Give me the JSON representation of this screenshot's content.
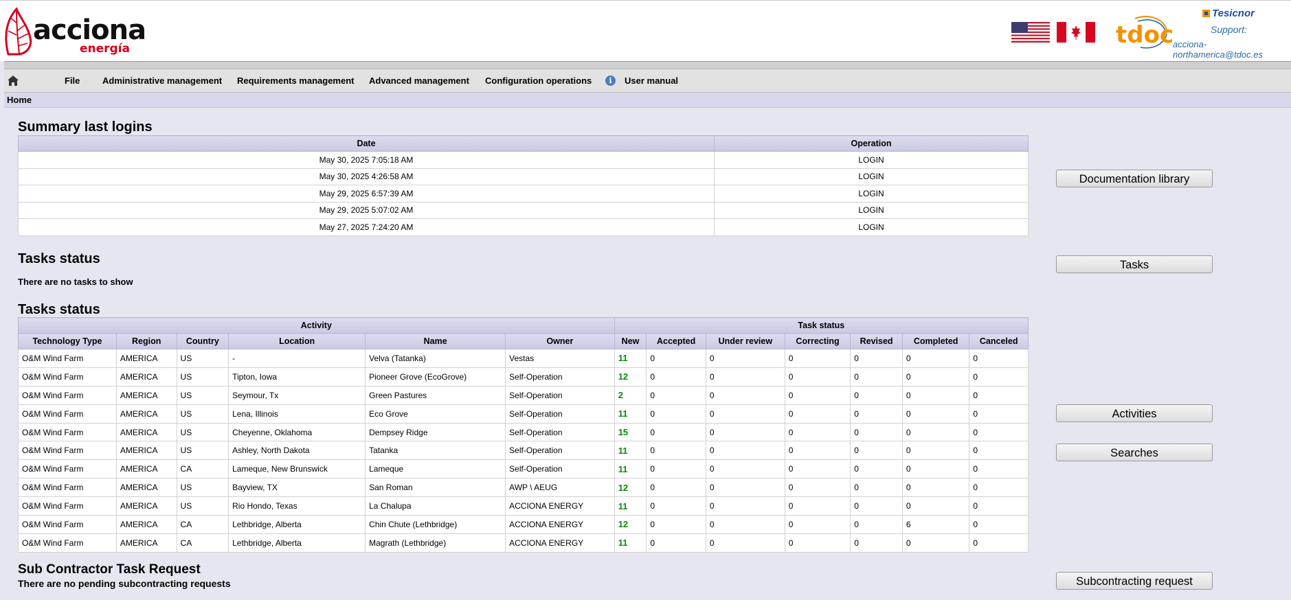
{
  "brand": {
    "name": "acciona",
    "sub": "energía"
  },
  "header": {
    "partner_logo": "tdoc",
    "vendor": "Tesicnor",
    "support_label": "Support:",
    "support_email": "acciona-northamerica@tdoc.es"
  },
  "menu": {
    "items": [
      "File",
      "Administrative management",
      "Requirements management",
      "Advanced management",
      "Configuration operations",
      "User manual"
    ]
  },
  "breadcrumb": "Home",
  "logins": {
    "title": "Summary last logins",
    "columns": [
      "Date",
      "Operation"
    ],
    "rows": [
      [
        "May 30, 2025 7:05:18 AM",
        "LOGIN"
      ],
      [
        "May 30, 2025 4:26:58 AM",
        "LOGIN"
      ],
      [
        "May 29, 2025 6:57:39 AM",
        "LOGIN"
      ],
      [
        "May 29, 2025 5:07:02 AM",
        "LOGIN"
      ],
      [
        "May 27, 2025 7:24:20 AM",
        "LOGIN"
      ]
    ]
  },
  "tasks_status_empty": {
    "title": "Tasks status",
    "message": "There are no tasks to show"
  },
  "tasks_table": {
    "title": "Tasks status",
    "group_headers": [
      "Activity",
      "Task status"
    ],
    "columns": [
      "Technology Type",
      "Region",
      "Country",
      "Location",
      "Name",
      "Owner",
      "New",
      "Accepted",
      "Under review",
      "Correcting",
      "Revised",
      "Completed",
      "Canceled"
    ],
    "rows": [
      [
        "O&M Wind Farm",
        "AMERICA",
        "US",
        "-",
        "Velva (Tatanka)",
        "Vestas",
        "11",
        "0",
        "0",
        "0",
        "0",
        "0",
        "0"
      ],
      [
        "O&M Wind Farm",
        "AMERICA",
        "US",
        "Tipton, Iowa",
        "Pioneer Grove (EcoGrove)",
        "Self-Operation",
        "12",
        "0",
        "0",
        "0",
        "0",
        "0",
        "0"
      ],
      [
        "O&M Wind Farm",
        "AMERICA",
        "US",
        "Seymour, Tx",
        "Green Pastures",
        "Self-Operation",
        "2",
        "0",
        "0",
        "0",
        "0",
        "0",
        "0"
      ],
      [
        "O&M Wind Farm",
        "AMERICA",
        "US",
        "Lena, Illinois",
        "Eco Grove",
        "Self-Operation",
        "11",
        "0",
        "0",
        "0",
        "0",
        "0",
        "0"
      ],
      [
        "O&M Wind Farm",
        "AMERICA",
        "US",
        "Cheyenne, Oklahoma",
        "Dempsey Ridge",
        "Self-Operation",
        "15",
        "0",
        "0",
        "0",
        "0",
        "0",
        "0"
      ],
      [
        "O&M Wind Farm",
        "AMERICA",
        "US",
        "Ashley, North Dakota",
        "Tatanka",
        "Self-Operation",
        "11",
        "0",
        "0",
        "0",
        "0",
        "0",
        "0"
      ],
      [
        "O&M Wind Farm",
        "AMERICA",
        "CA",
        "Lameque, New Brunswick",
        "Lameque",
        "Self-Operation",
        "11",
        "0",
        "0",
        "0",
        "0",
        "0",
        "0"
      ],
      [
        "O&M Wind Farm",
        "AMERICA",
        "US",
        "Bayview, TX",
        "San Roman",
        "AWP \\ AEUG",
        "12",
        "0",
        "0",
        "0",
        "0",
        "0",
        "0"
      ],
      [
        "O&M Wind Farm",
        "AMERICA",
        "US",
        "Rio Hondo, Texas",
        "La Chalupa",
        "ACCIONA ENERGY",
        "11",
        "0",
        "0",
        "0",
        "0",
        "0",
        "0"
      ],
      [
        "O&M Wind Farm",
        "AMERICA",
        "CA",
        "Lethbridge, Alberta",
        "Chin Chute (Lethbridge)",
        "ACCIONA ENERGY",
        "12",
        "0",
        "0",
        "0",
        "0",
        "6",
        "0"
      ],
      [
        "O&M Wind Farm",
        "AMERICA",
        "CA",
        "Lethbridge, Alberta",
        "Magrath (Lethbridge)",
        "ACCIONA ENERGY",
        "11",
        "0",
        "0",
        "0",
        "0",
        "0",
        "0"
      ]
    ]
  },
  "subcontract": {
    "title": "Sub Contractor Task Request",
    "message": "There are no pending subcontracting requests"
  },
  "side_buttons": {
    "documentation": "Documentation library",
    "tasks": "Tasks",
    "activities": "Activities",
    "searches": "Searches",
    "subcontracting": "Subcontracting request"
  },
  "colors": {
    "brand_red": "#d6001c",
    "new_count_green": "#0a8a0a",
    "tdoc_orange": "#f39200",
    "tdoc_blue": "#1c5f9c"
  },
  "icons": [
    "home-icon",
    "info-icon",
    "flag-us-icon",
    "flag-ca-icon"
  ]
}
